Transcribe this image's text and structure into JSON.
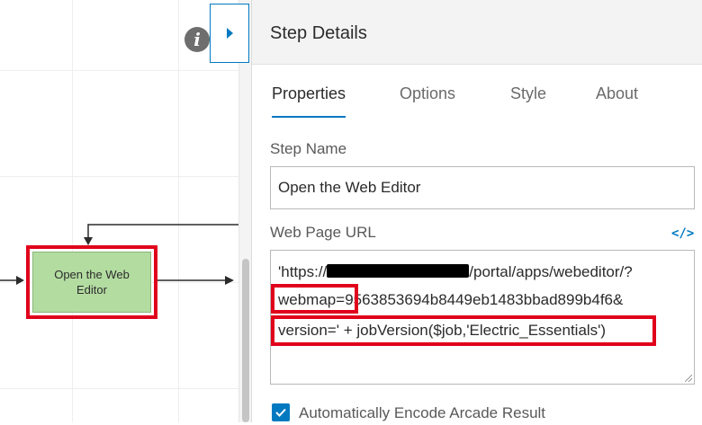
{
  "canvas": {
    "step_node_label": "Open the Web Editor"
  },
  "icons": {
    "info": "info-icon",
    "collapse": "chevron-right-icon",
    "code": "code-icon",
    "checkbox": "checkmark-icon"
  },
  "panel": {
    "title": "Step Details",
    "tabs": [
      {
        "label": "Properties",
        "active": true
      },
      {
        "label": "Options",
        "active": false
      },
      {
        "label": "Style",
        "active": false
      },
      {
        "label": "About",
        "active": false
      }
    ],
    "step_name": {
      "label": "Step Name",
      "value": "Open the Web Editor"
    },
    "web_page_url": {
      "label": "Web Page URL",
      "code_toggle": "</>",
      "line1_prefix": "'https://",
      "line1_suffix": "/portal/apps/webeditor/?",
      "line2_key": "webmap=",
      "line2_value": "9563853694b8449eb1483bbad899b4f6&",
      "line3": "version=' + jobVersion($job,'Electric_Essentials')"
    },
    "encode_checkbox": {
      "label": "Automatically Encode Arcade Result",
      "checked": true
    }
  },
  "colors": {
    "accent": "#0079c1",
    "highlight": "#e0001b",
    "node_fill": "#b3dca1"
  }
}
